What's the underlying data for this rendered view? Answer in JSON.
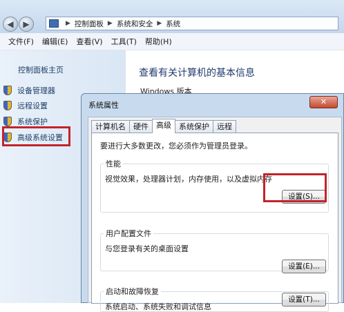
{
  "address_bar": {
    "crumbs": [
      "控制面板",
      "系统和安全",
      "系统"
    ]
  },
  "menu": [
    "文件(F)",
    "编辑(E)",
    "查看(V)",
    "工具(T)",
    "帮助(H)"
  ],
  "left_pane": {
    "home": "控制面板主页",
    "tasks": [
      "设备管理器",
      "远程设置",
      "系统保护",
      "高级系统设置"
    ]
  },
  "main": {
    "title": "查看有关计算机的基本信息",
    "windows_edition_label": "Windows 版本"
  },
  "dialog": {
    "title": "系统属性",
    "close_glyph": "✕",
    "tabs": [
      "计算机名",
      "硬件",
      "高级",
      "系统保护",
      "远程"
    ],
    "active_tab": "高级",
    "admin_note": "要进行大多数更改，您必须作为管理员登录。",
    "performance": {
      "title": "性能",
      "desc": "视觉效果，处理器计划，内存使用，以及虚拟内存",
      "button": "设置(S)..."
    },
    "user_profiles": {
      "title": "用户配置文件",
      "desc": "与您登录有关的桌面设置",
      "button": "设置(E)..."
    },
    "startup_recovery": {
      "title": "启动和故障恢复",
      "desc": "系统启动、系统失败和调试信息",
      "button": "设置(T)..."
    }
  },
  "colors": {
    "highlight": "#c2232a",
    "link": "#1e3f66",
    "title_blue": "#1e3b6e"
  }
}
